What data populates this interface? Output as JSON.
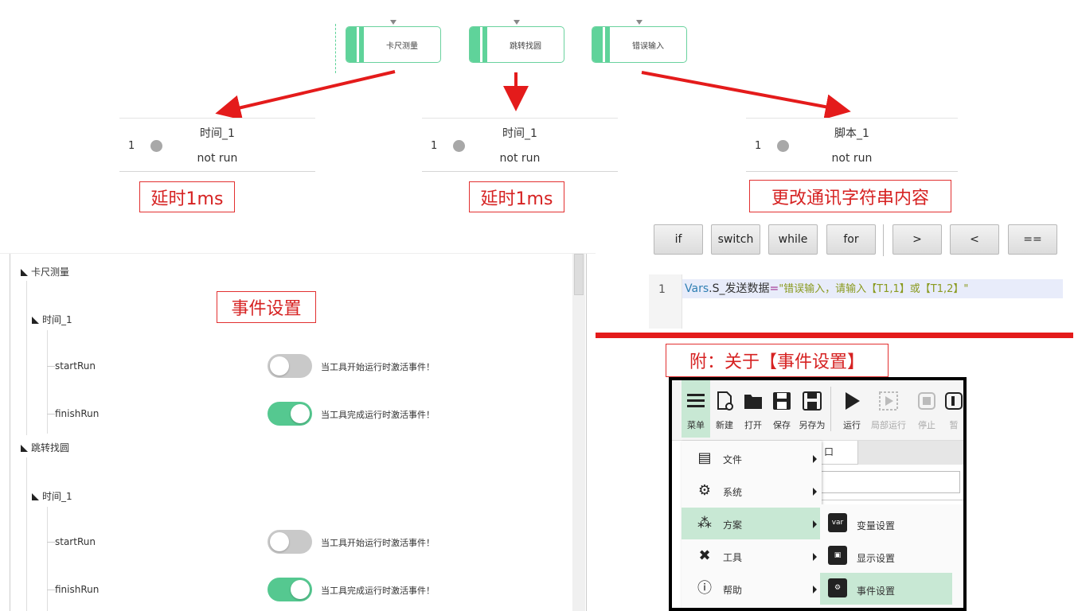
{
  "flow_nodes": [
    "卡尺测量",
    "跳转找圆",
    "错误输入"
  ],
  "cards": [
    {
      "num": "1",
      "name": "时间_1",
      "status": "not run"
    },
    {
      "num": "1",
      "name": "时间_1",
      "status": "not run"
    },
    {
      "num": "1",
      "name": "脚本_1",
      "status": "not run"
    }
  ],
  "annotations": {
    "delay1": "延时1ms",
    "delay2": "延时1ms",
    "script": "更改通讯字符串内容",
    "event_settings": "事件设置",
    "appendix": "附：关于【事件设置】"
  },
  "script_toolbar": [
    "if",
    "switch",
    "while",
    "for",
    ">",
    "<",
    "=="
  ],
  "code": {
    "line_no": "1",
    "prefix": "Vars",
    "dot": ".",
    "var": "S_发送数据",
    "eq": "=",
    "string": "\"错误输入，请输入【T1,1】或【T1,2】\""
  },
  "event_tree": {
    "groups": [
      {
        "title": "卡尺测量",
        "sub": "时间_1",
        "events": [
          {
            "name": "startRun",
            "on": false,
            "desc": "当工具开始运行时激活事件！"
          },
          {
            "name": "finishRun",
            "on": true,
            "desc": "当工具完成运行时激活事件！"
          }
        ]
      },
      {
        "title": "跳转找圆",
        "sub": "时间_1",
        "events": [
          {
            "name": "startRun",
            "on": false,
            "desc": "当工具开始运行时激活事件！"
          },
          {
            "name": "finishRun",
            "on": true,
            "desc": "当工具完成运行时激活事件！"
          }
        ]
      }
    ]
  },
  "menu_screenshot": {
    "toolbar": [
      {
        "label": "菜单",
        "icon": "menu-icon"
      },
      {
        "label": "新建",
        "icon": "new-file-icon"
      },
      {
        "label": "打开",
        "icon": "folder-open-icon"
      },
      {
        "label": "保存",
        "icon": "save-icon"
      },
      {
        "label": "另存为",
        "icon": "save-as-icon"
      },
      {
        "label": "运行",
        "icon": "play-icon"
      },
      {
        "label": "局部运行",
        "icon": "partial-run-icon"
      },
      {
        "label": "停止",
        "icon": "stop-icon"
      },
      {
        "label": "暂",
        "icon": "pause-icon"
      }
    ],
    "tab_text": "口",
    "menu_items": [
      {
        "label": "文件",
        "icon": "file-icon"
      },
      {
        "label": "系统",
        "icon": "system-icon"
      },
      {
        "label": "方案",
        "icon": "scheme-icon"
      },
      {
        "label": "工具",
        "icon": "tools-icon"
      },
      {
        "label": "帮助",
        "icon": "help-icon"
      }
    ],
    "submenu_items": [
      {
        "label": "变量设置",
        "icon": "variable-icon"
      },
      {
        "label": "显示设置",
        "icon": "display-icon"
      },
      {
        "label": "事件设置",
        "icon": "event-icon"
      }
    ]
  },
  "colors": {
    "accent_green": "#5fd39a",
    "arrow_red": "#e41b1b",
    "toggle_on": "#55c890",
    "menu_highlight": "#c8e8d4"
  }
}
